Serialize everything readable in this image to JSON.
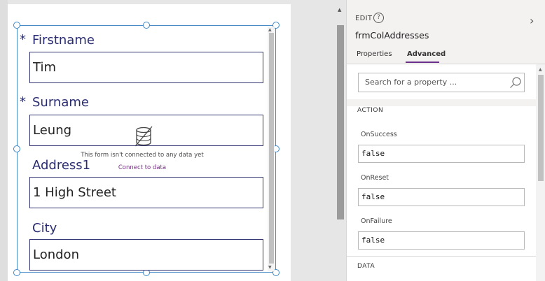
{
  "form": {
    "fields": [
      {
        "label": "Firstname",
        "value": "Tim",
        "required": true
      },
      {
        "label": "Surname",
        "value": "Leung",
        "required": true
      },
      {
        "label": "Address1",
        "value": "1 High Street",
        "required": false
      },
      {
        "label": "City",
        "value": "London",
        "required": false
      }
    ],
    "required_marker": "*",
    "empty_message": "This form isn't connected to any data yet",
    "connect_link": "Connect to data"
  },
  "panel": {
    "edit_label": "EDIT",
    "help_glyph": "?",
    "control_name": "frmColAddresses",
    "tabs": [
      {
        "label": "Properties",
        "active": false
      },
      {
        "label": "Advanced",
        "active": true
      }
    ],
    "search_placeholder": "Search for a property ...",
    "sections": [
      {
        "heading": "ACTION",
        "properties": [
          {
            "label": "OnSuccess",
            "value": "false"
          },
          {
            "label": "OnReset",
            "value": "false"
          },
          {
            "label": "OnFailure",
            "value": "false"
          }
        ]
      },
      {
        "heading": "DATA",
        "properties": []
      }
    ]
  },
  "colors": {
    "accent": "#6b2f8c",
    "selection": "#3f86c4",
    "label": "#2b2d72"
  }
}
